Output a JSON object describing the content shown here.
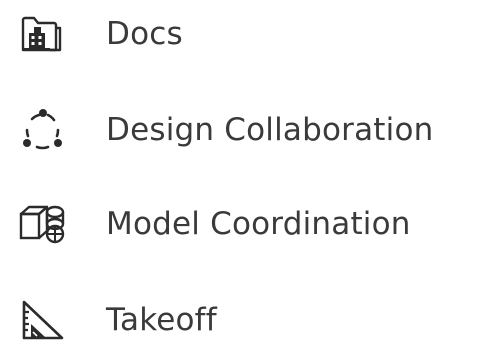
{
  "menu": {
    "items": [
      {
        "label": "Docs",
        "icon": "folder-building-icon"
      },
      {
        "label": "Design Collaboration",
        "icon": "circle-dots-icon"
      },
      {
        "label": "Model Coordination",
        "icon": "cube-model-icon"
      },
      {
        "label": "Takeoff",
        "icon": "set-square-ruler-icon"
      }
    ]
  },
  "colors": {
    "text": "#3a3a3a",
    "icon": "#2b2b2b",
    "background": "#ffffff"
  }
}
